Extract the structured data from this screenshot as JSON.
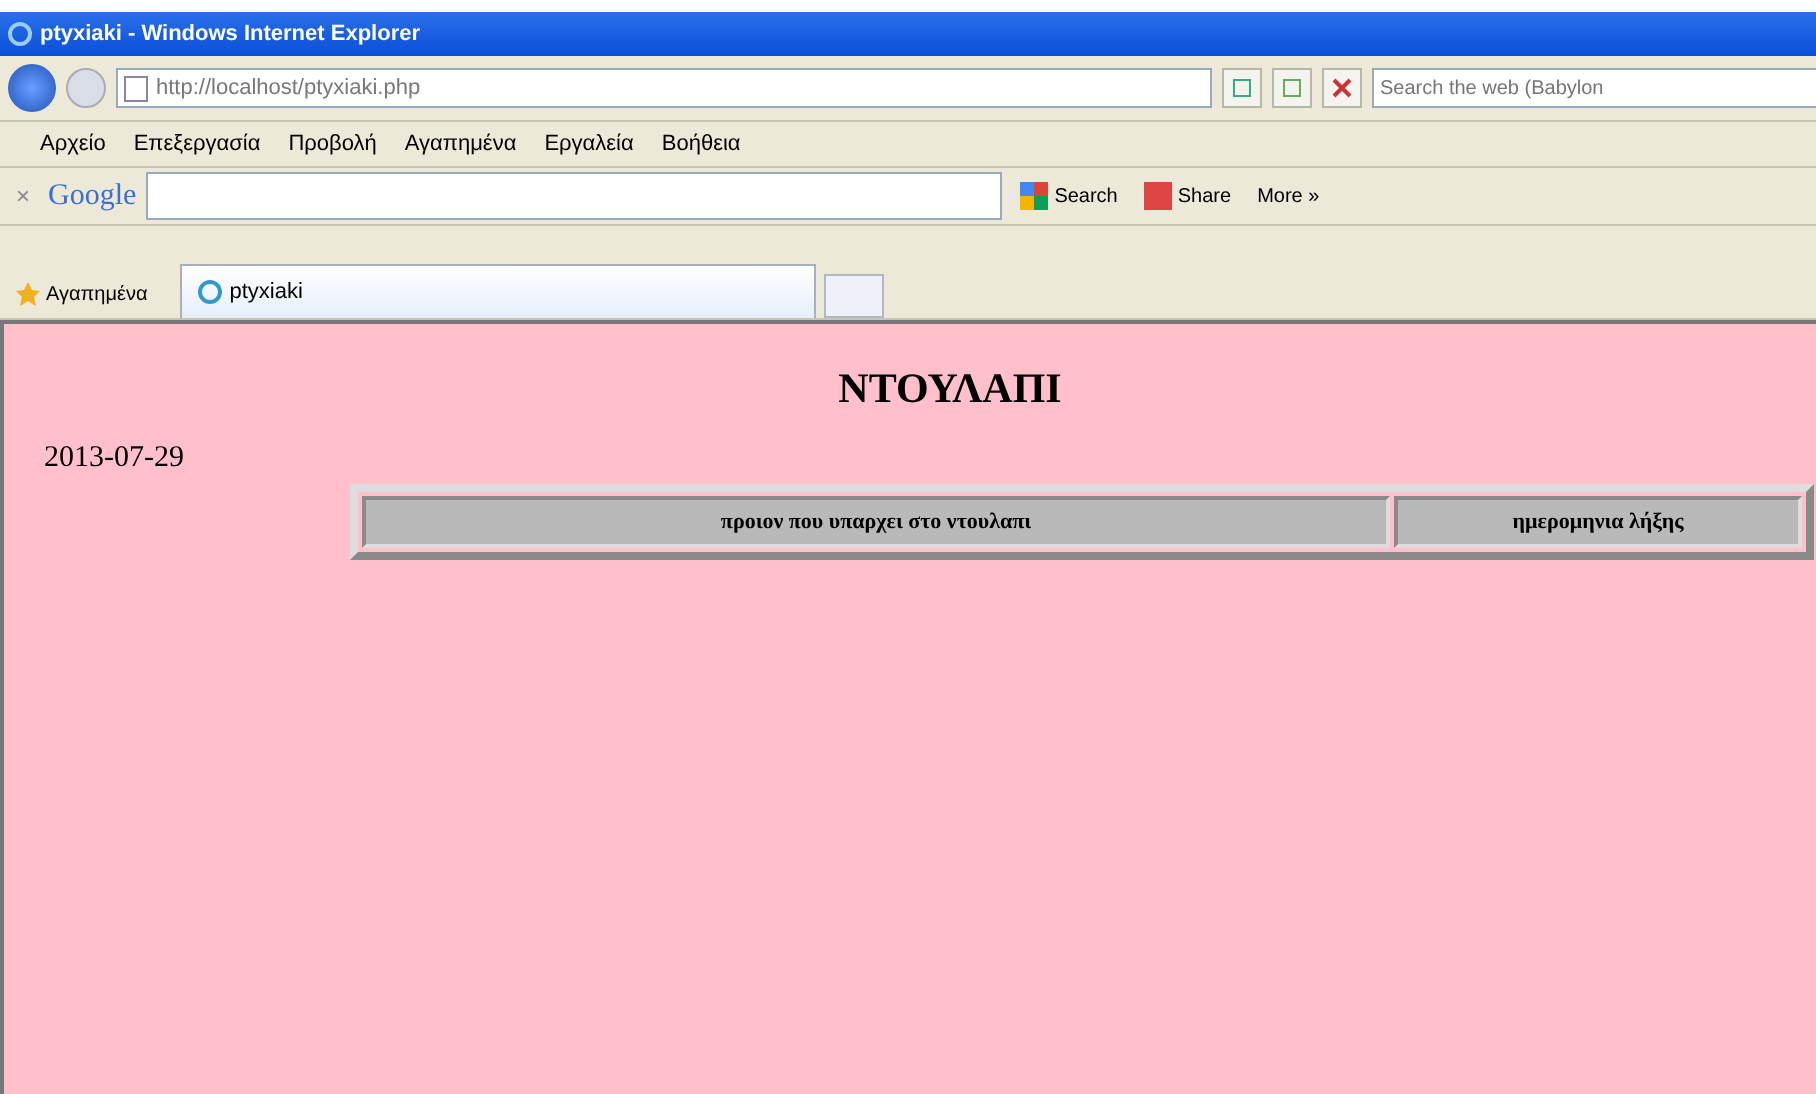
{
  "window": {
    "title": "ptyxiaki - Windows Internet Explorer"
  },
  "address_bar": {
    "url": "http://localhost/ptyxiaki.php"
  },
  "search": {
    "placeholder": "Search the web (Babylon"
  },
  "menu": [
    "Αρχείο",
    "Επεξεργασία",
    "Προβολή",
    "Αγαπημένα",
    "Εργαλεία",
    "Βοήθεια"
  ],
  "google_toolbar": {
    "close": "×",
    "logo": "Google",
    "buttons": [
      {
        "label": "Search",
        "kind": "search"
      },
      {
        "label": "Share",
        "kind": "share"
      },
      {
        "label": "More »",
        "kind": "more"
      }
    ]
  },
  "favorites": {
    "label": "Αγαπημένα"
  },
  "tabs": [
    {
      "label": "ptyxiaki",
      "selected": true
    }
  ],
  "page": {
    "heading": "ΝΤΟΥΛΑΠΙ",
    "date": "2013-07-29",
    "table": {
      "columns": [
        "προιον που υπαρχει στο ντουλαπι",
        "ημερομηνια λήξης"
      ]
    }
  }
}
